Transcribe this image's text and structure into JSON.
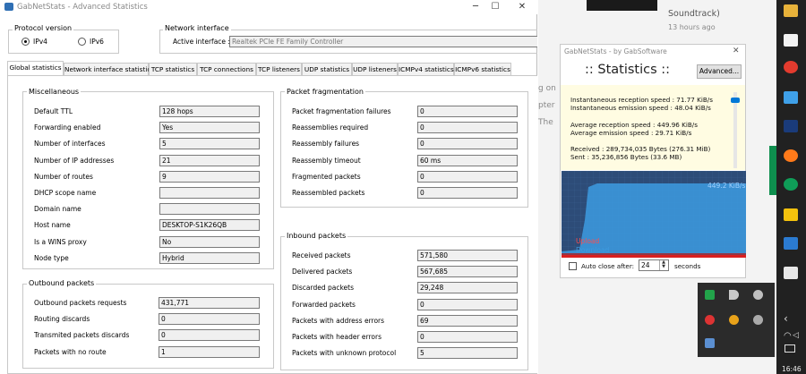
{
  "window": {
    "title": "GabNetStats - Advanced Statistics",
    "minimize": "─",
    "maximize": "☐",
    "close": "✕"
  },
  "protocol": {
    "group_label": "Protocol version",
    "ipv4": "IPv4",
    "ipv6": "IPv6",
    "selected": "IPv4"
  },
  "network": {
    "group_label": "Network interface",
    "active_label": "Active interface :",
    "value": "Realtek PCIe FE Family Controller"
  },
  "tabs": [
    "Global statistics",
    "Network interface statistics",
    "TCP statistics",
    "TCP connections",
    "TCP listeners",
    "UDP statistics",
    "UDP listeners",
    "ICMPv4 statistics",
    "ICMPv6 statistics"
  ],
  "misc": {
    "label": "Miscellaneous",
    "rows": [
      {
        "label": "Default TTL",
        "value": "128 hops"
      },
      {
        "label": "Forwarding enabled",
        "value": "Yes"
      },
      {
        "label": "Number of interfaces",
        "value": "5"
      },
      {
        "label": "Number of IP addresses",
        "value": "21"
      },
      {
        "label": "Number of routes",
        "value": "9"
      },
      {
        "label": "DHCP scope name",
        "value": ""
      },
      {
        "label": "Domain name",
        "value": ""
      },
      {
        "label": "Host name",
        "value": "DESKTOP-S1K26QB"
      },
      {
        "label": "Is a WINS proxy",
        "value": "No"
      },
      {
        "label": "Node type",
        "value": "Hybrid"
      }
    ]
  },
  "frag": {
    "label": "Packet fragmentation",
    "rows": [
      {
        "label": "Packet fragmentation failures",
        "value": "0"
      },
      {
        "label": "Reassemblies required",
        "value": "0"
      },
      {
        "label": "Reassembly failures",
        "value": "0"
      },
      {
        "label": "Reassembly timeout",
        "value": "60 ms"
      },
      {
        "label": "Fragmented packets",
        "value": "0"
      },
      {
        "label": "Reassembled packets",
        "value": "0"
      }
    ]
  },
  "outbound": {
    "label": "Outbound packets",
    "rows": [
      {
        "label": "Outbound packets requests",
        "value": "431,771"
      },
      {
        "label": "Routing discards",
        "value": "0"
      },
      {
        "label": "Transmited packets discards",
        "value": "0"
      },
      {
        "label": "Packets with no route",
        "value": "1"
      }
    ]
  },
  "inbound": {
    "label": "Inbound packets",
    "rows": [
      {
        "label": "Received packets",
        "value": "571,580"
      },
      {
        "label": "Delivered packets",
        "value": "567,685"
      },
      {
        "label": "Discarded packets",
        "value": "29,248"
      },
      {
        "label": "Forwarded packets",
        "value": "0"
      },
      {
        "label": "Packets with address errors",
        "value": "69"
      },
      {
        "label": "Packets with header errors",
        "value": "0"
      },
      {
        "label": "Packets with unknown protocol",
        "value": "5"
      }
    ]
  },
  "background": {
    "top_text": "Soundtrack)",
    "time_text": "13 hours ago",
    "frag1": "g on",
    "frag2": "pter",
    "frag3": "The"
  },
  "widget": {
    "title": "GabNetStats - by GabSoftware",
    "close": "✕",
    "heading": ":: Statistics ::",
    "advanced": "Advanced...",
    "lines": [
      "Instantaneous reception speed : 71.77 KiB/s",
      "Instantaneous emission speed : 48.04 KiB/s",
      "Average reception speed : 449.96 KiB/s",
      "Average emission speed : 29.71 KiB/s",
      "Received : 289,734,035 Bytes (276.31 MiB)",
      "Sent : 35,236,856 Bytes (33.6 MB)"
    ],
    "graph_label": "449.2 KiB/s",
    "upload": "Upload",
    "download": "Download",
    "autoclose_label": "Auto close after:",
    "autoclose_value": "24",
    "seconds": "seconds",
    "autoclose_checked": false
  },
  "clock": "16:46",
  "colors": {
    "accent": "#0078d7",
    "upload": "#d92020",
    "download": "#3d9be0",
    "graph_bg": "#2d4c78"
  }
}
